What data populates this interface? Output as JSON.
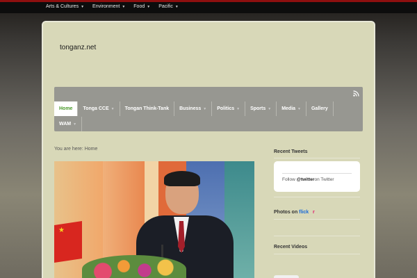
{
  "topnav": {
    "items": [
      {
        "label": "Arts & Cultures"
      },
      {
        "label": "Environment"
      },
      {
        "label": "Food"
      },
      {
        "label": "Pacific"
      }
    ]
  },
  "site": {
    "title": "tonganz.net"
  },
  "mainnav": {
    "row1": [
      {
        "label": "Home",
        "dropdown": false
      },
      {
        "label": "Tonga CCE",
        "dropdown": true
      },
      {
        "label": "Tongan Think-Tank",
        "dropdown": false
      },
      {
        "label": "Business",
        "dropdown": true
      },
      {
        "label": "Politics",
        "dropdown": true
      },
      {
        "label": "Sports",
        "dropdown": true
      },
      {
        "label": "Media",
        "dropdown": true
      },
      {
        "label": "Gallery",
        "dropdown": false
      }
    ],
    "row2": [
      {
        "label": "WAM",
        "dropdown": true
      }
    ],
    "active_label": "Home"
  },
  "breadcrumb": {
    "prefix": "You are here:",
    "current": "Home"
  },
  "sidebar": {
    "tweets_title": "Recent Tweets",
    "follow_prefix": "Follow",
    "follow_handle": "@twitter",
    "follow_suffix": "on Twitter",
    "photos_title": "Photos on",
    "flickr_f": "flick",
    "flickr_r": "r",
    "videos_title": "Recent Videos"
  },
  "colors": {
    "top_border": "#8e0f0f",
    "nav_bg": "#979791",
    "card_bg": "#d8d8b8",
    "active_text": "#4a9a2a"
  },
  "icons": {
    "rss": "rss-icon",
    "caret": "chevron-down-icon"
  }
}
